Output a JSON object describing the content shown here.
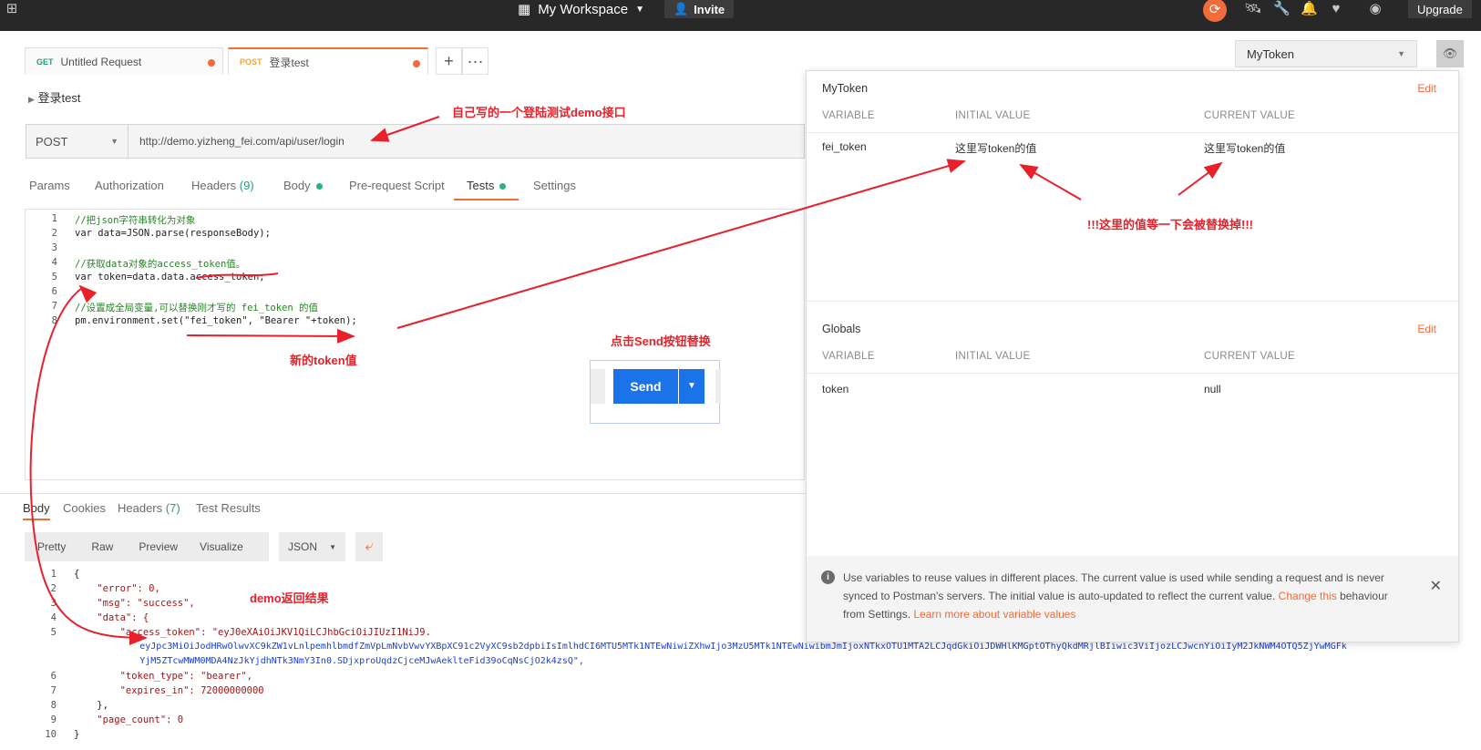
{
  "topbar": {
    "workspace": "My Workspace",
    "invite": "Invite",
    "upgrade": "Upgrade"
  },
  "tabs": [
    {
      "method": "GET",
      "name": "Untitled Request"
    },
    {
      "method": "POST",
      "name": "登录test"
    }
  ],
  "breadcrumb": "登录test",
  "env_selector": "MyToken",
  "request": {
    "method": "POST",
    "url": "http://demo.yizheng_fei.com/api/user/login",
    "subtabs": {
      "params": "Params",
      "authorization": "Authorization",
      "headers": "Headers",
      "headers_count": "(9)",
      "body": "Body",
      "prerequest": "Pre-request Script",
      "tests": "Tests",
      "settings": "Settings"
    }
  },
  "editor": {
    "line_numbers": [
      "1",
      "2",
      "3",
      "4",
      "5",
      "6",
      "7",
      "8"
    ],
    "lines": [
      "//把json字符串转化为对象",
      "var data=JSON.parse(responseBody);",
      "",
      "//获取data对象的access_token值。",
      "var token=data.data.access_token;",
      "",
      "//设置成全局变量,可以替换刚才写的 fei_token 的值",
      "pm.environment.set(\"fei_token\", \"Bearer \"+token);"
    ]
  },
  "send": {
    "label": "Send"
  },
  "env_panel": {
    "env_name": "MyToken",
    "edit": "Edit",
    "col_variable": "VARIABLE",
    "col_initial": "INITIAL VALUE",
    "col_current": "CURRENT VALUE",
    "env_rows": [
      {
        "variable": "fei_token",
        "initial": "这里写token的值",
        "current": "这里写token的值"
      }
    ],
    "globals_name": "Globals",
    "global_rows": [
      {
        "variable": "token",
        "initial": "",
        "current": "null"
      }
    ],
    "info_text": "Use variables to reuse values in different places. The current value is used while sending a request and is never synced to Postman's servers. The initial value is auto-updated to reflect the current value.",
    "info_link1": "Change this",
    "info_mid": "behaviour from Settings.",
    "info_link2": "Learn more about variable values"
  },
  "response": {
    "tabs": {
      "body": "Body",
      "cookies": "Cookies",
      "headers": "Headers",
      "headers_count": "(7)",
      "test_results": "Test Results"
    },
    "views": {
      "pretty": "Pretty",
      "raw": "Raw",
      "preview": "Preview",
      "visualize": "Visualize"
    },
    "format": "JSON",
    "line_numbers": [
      "1",
      "2",
      "3",
      "4",
      "5",
      "",
      "",
      "6",
      "7",
      "8",
      "9",
      "10"
    ],
    "lines": [
      "{",
      "    \"error\": 0,",
      "    \"msg\": \"success\",",
      "    \"data\": {",
      "        \"access_token\": \"eyJ0eXAiOiJKV1QiLCJhbGciOiJIUzI1NiJ9.",
      "            eyJpc3MiOiJodHRwOlwvXC9kZW1vLnlpemhlbmdfZmVpLmNvbVwvYXBpXC91c2VyXC9sb2dpbiIsImlhdCI6MTU5MTk1NTEwNiwiZXhwIjo3MzU5MTk1NTEwNiwibmJmIjoxNTkxOTU1MTA2LCJqdGkiOiJDWHlKMGptOThyQkdMRjlBIiwic3ViIjozLCJwcnYiOiIyM2JkNWM4OTQ5ZjYwMGFk",
      "            YjM5ZTcwMWM0MDA4NzJkYjdhNTk3NmY3In0.SDjxproUqdzCjceMJwAeklteFid39oCqNsCjO2k4zsQ\",",
      "        \"token_type\": \"bearer\",",
      "        \"expires_in\": 72000000000",
      "    },",
      "    \"page_count\": 0",
      "}"
    ]
  },
  "annotations": {
    "a1": "自己写的一个登陆测试demo接口",
    "a2": "!!!这里的值等一下会被替换掉!!!",
    "a3": "点击Send按钮替换",
    "a4": "新的token值",
    "a5": "demo返回结果"
  },
  "colors": {
    "accent": "#f26b3a",
    "send": "#1a73e8",
    "annotation": "#e8202a",
    "tests_dot": "#26b47f"
  }
}
